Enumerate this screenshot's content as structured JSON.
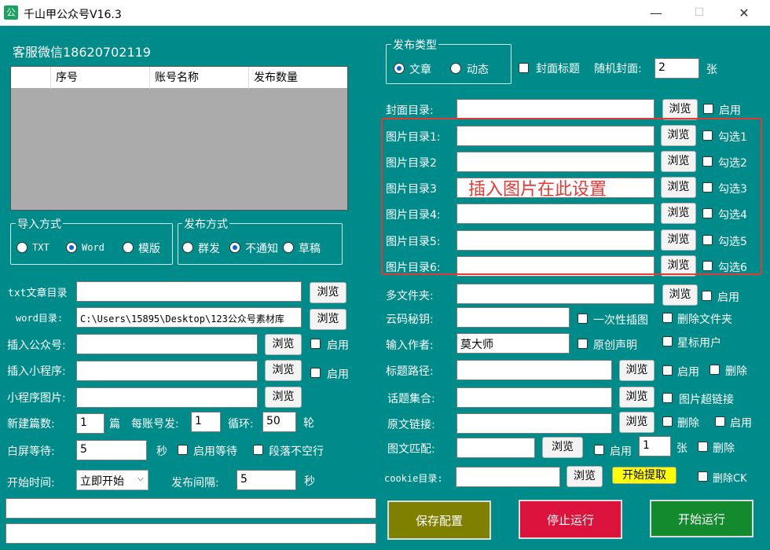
{
  "window": {
    "app_icon": "公",
    "title": "千山甲公众号V16.3",
    "minimize": "—",
    "maximize": "☐",
    "close": "✕"
  },
  "left": {
    "service": "客服微信18620702119",
    "table_headers": [
      "",
      "序号",
      "账号名称",
      "发布数量"
    ],
    "import_group": {
      "title": "导入方式",
      "options": [
        "TXT",
        "Word",
        "模版"
      ],
      "selected": "Word"
    },
    "publish_mode_group": {
      "title": "发布方式",
      "options": [
        "群发",
        "不通知",
        "草稿"
      ],
      "selected": "不通知"
    },
    "txt_dir_label": "txt文章目录",
    "txt_dir_value": "",
    "word_dir_label": "word目录:",
    "word_dir_value": "C:\\Users\\15895\\Desktop\\123公众号素材库",
    "insert_account_label": "插入公众号:",
    "insert_miniprogram_label": "插入小程序:",
    "miniprogram_image_label": "小程序图片:",
    "browse": "浏览",
    "enable": "启用",
    "new_articles_label": "新建篇数:",
    "new_articles_value": "1",
    "unit_pian": "篇",
    "per_account_label": "每账号发:",
    "per_account_value": "1",
    "loop_label": "循环:",
    "loop_value": "50",
    "unit_lun": "轮",
    "white_wait_label": "白屏等待:",
    "white_wait_value": "5",
    "unit_sec": "秒",
    "enable_wait": "启用等待",
    "no_blank_line": "段落不空行",
    "start_time_label": "开始时间:",
    "start_time_value": "立即开始",
    "interval_label": "发布间隔:",
    "interval_value": "5"
  },
  "right": {
    "type_group": {
      "title": "发布类型",
      "options": [
        "文章",
        "动态"
      ],
      "selected": "文章"
    },
    "cover_title": "封面标题",
    "random_cover_label": "随机封面:",
    "random_cover_value": "2",
    "unit_zhang": "张",
    "cover_dir_label": "封面目录:",
    "image_dirs": [
      {
        "label": "图片目录1:",
        "check": "勾选1"
      },
      {
        "label": "图片目录2",
        "check": "勾选2"
      },
      {
        "label": "图片目录3",
        "check": "勾选3"
      },
      {
        "label": "图片目录4:",
        "check": "勾选4"
      },
      {
        "label": "图片目录5:",
        "check": "勾选5"
      },
      {
        "label": "图片目录6:",
        "check": "勾选6"
      }
    ],
    "annotation": "插入图片在此设置",
    "multi_folder_label": "多文件夹:",
    "cloud_key_label": "云码秘钥:",
    "one_time_insert": "一次性插图",
    "delete_folder": "删除文件夹",
    "author_label": "输入作者:",
    "author_value": "莫大师",
    "original": "原创声明",
    "star_user": "星标用户",
    "title_path_label": "标题路径:",
    "delete": "删除",
    "topic_label": "话题集合:",
    "image_hyperlink": "图片超链接",
    "origin_link_label": "原文链接:",
    "image_match_label": "图文匹配:",
    "image_match_value": "1",
    "cookie_label": "cookie目录:",
    "start_extract": "开始提取",
    "delete_ck": "删除CK",
    "save_config": "保存配置",
    "stop_run": "停止运行",
    "start_run": "开始运行"
  },
  "colors": {
    "background": "#008b8b",
    "save_button": "#808000",
    "stop_button": "#dc143c",
    "start_button": "#138a2e",
    "annotation": "#e53935",
    "extract_button": "#ffff00"
  }
}
